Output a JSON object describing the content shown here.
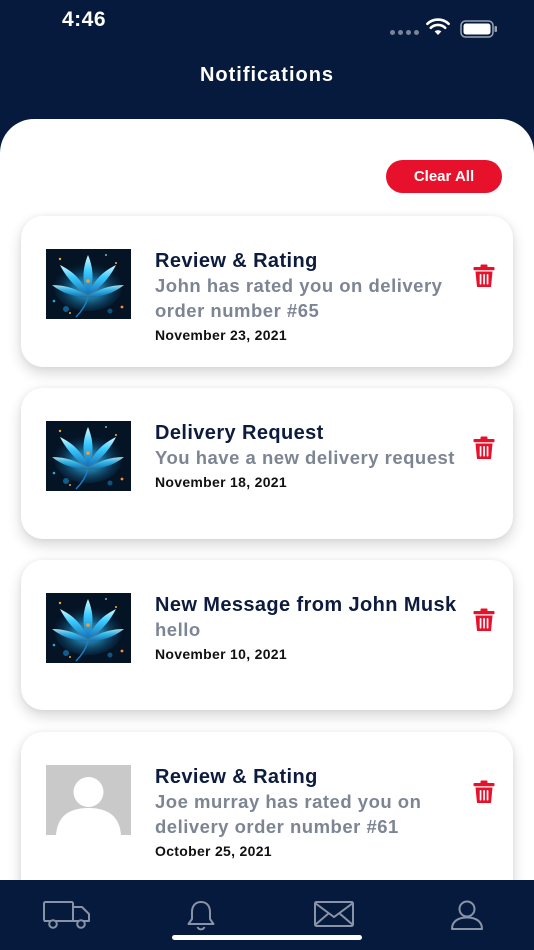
{
  "status_bar": {
    "time": "4:46"
  },
  "header": {
    "title": "Notifications"
  },
  "actions": {
    "clear_all_label": "Clear All"
  },
  "notifications": [
    {
      "title": "Review & Rating",
      "message": "John has rated you on delivery order number #65",
      "date": "November 23, 2021",
      "thumbnail": "flower-image"
    },
    {
      "title": "Delivery Request",
      "message": "You have a new delivery request",
      "date": "November 18, 2021",
      "thumbnail": "flower-image"
    },
    {
      "title": "New Message from John Musk",
      "message": "hello",
      "date": "November 10, 2021",
      "thumbnail": "flower-image"
    },
    {
      "title": "Review & Rating",
      "message": "Joe murray has rated you on delivery order number #61",
      "date": "October 25, 2021",
      "thumbnail": "avatar-placeholder"
    }
  ],
  "bottom_nav": [
    {
      "icon": "truck-icon"
    },
    {
      "icon": "bell-icon"
    },
    {
      "icon": "envelope-icon"
    },
    {
      "icon": "user-icon"
    }
  ],
  "colors": {
    "navy": "#061a3d",
    "accent_red": "#e8112b",
    "title_text": "#0d1b3e",
    "message_text": "#7d8594"
  }
}
